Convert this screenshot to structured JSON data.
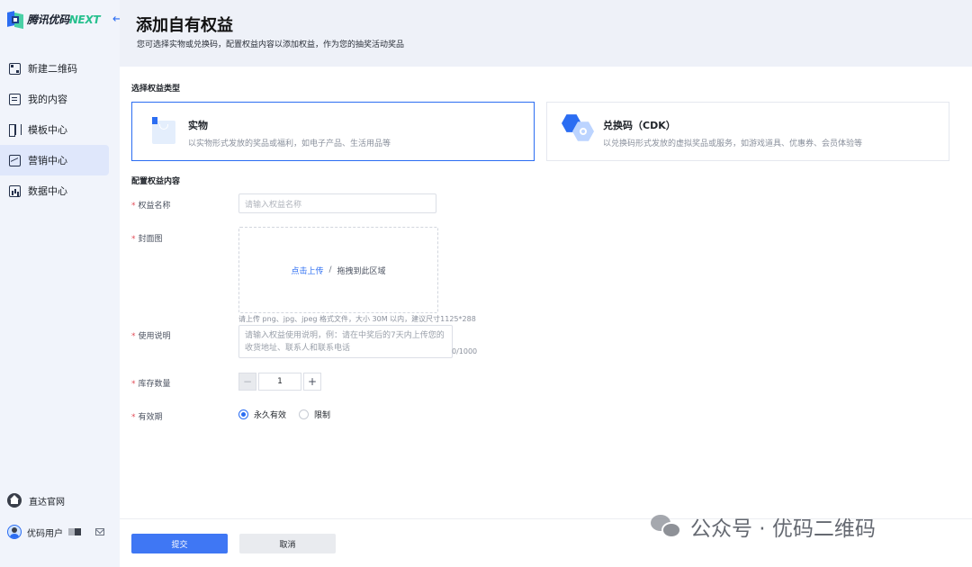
{
  "brand": {
    "name": "腾讯优码",
    "suffix": "NEXT"
  },
  "sidebar": {
    "items": [
      {
        "label": "新建二维码",
        "icon": "qrcode-icon"
      },
      {
        "label": "我的内容",
        "icon": "document-icon"
      },
      {
        "label": "模板中心",
        "icon": "template-icon"
      },
      {
        "label": "营销中心",
        "icon": "marketing-icon",
        "active": true
      },
      {
        "label": "数据中心",
        "icon": "data-chart-icon"
      }
    ],
    "official_site": "直达官网",
    "user_name": "优码用户"
  },
  "header": {
    "title": "添加自有权益",
    "subtitle": "您可选择实物或兑换码，配置权益内容以添加权益，作为您的抽奖活动奖品"
  },
  "section1": {
    "title": "选择权益类型",
    "types": [
      {
        "name": "实物",
        "desc": "以实物形式发放的奖品或福利，如电子产品、生活用品等",
        "selected": true
      },
      {
        "name": "兑换码（CDK）",
        "desc": "以兑换码形式发放的虚拟奖品或服务，如游戏道具、优惠券、会员体验等",
        "selected": false
      }
    ]
  },
  "section2": {
    "title": "配置权益内容",
    "name_label": "权益名称",
    "name_placeholder": "请输入权益名称",
    "cover_label": "封面图",
    "upload_link": "点击上传",
    "upload_sep": "/",
    "upload_drag": "拖拽到此区域",
    "upload_hint": "请上传 png、jpg、jpeg 格式文件，大小 30M 以内，建议尺寸1125*288",
    "usage_label": "使用说明",
    "usage_placeholder": "请输入权益使用说明，例：请在中奖后的7天内上传您的收货地址、联系人和联系电话",
    "usage_counter": "0/1000",
    "stock_label": "库存数量",
    "stock_value": "1",
    "stock_minus": "−",
    "stock_plus": "+",
    "validity_label": "有效期",
    "validity_options": [
      "永久有效",
      "限制"
    ],
    "validity_selected": "永久有效"
  },
  "footer": {
    "submit": "提交",
    "cancel": "取消"
  },
  "watermark": {
    "text": "公众号 · 优码二维码"
  },
  "colors": {
    "primary": "#2b6df2",
    "submit": "#3f77f4",
    "required": "#e34d59",
    "brand_green": "#27c08e"
  }
}
